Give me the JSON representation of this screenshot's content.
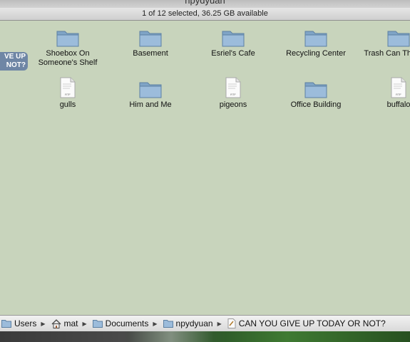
{
  "window": {
    "title": "npydyuan"
  },
  "status": {
    "text": "1 of 12 selected, 36.25 GB available"
  },
  "selected_item": {
    "label_line1": "VE UP",
    "label_line2": "NOT?"
  },
  "items": [
    {
      "label": "Shoebox On Someone's Shelf",
      "icon": "folder-icon"
    },
    {
      "label": "Basement",
      "icon": "folder-icon"
    },
    {
      "label": "Esriel's Cafe",
      "icon": "folder-icon"
    },
    {
      "label": "Recycling Center",
      "icon": "folder-icon"
    },
    {
      "label": "Trash Can The Corr",
      "icon": "folder-icon"
    },
    {
      "label": "gulls",
      "icon": "rtf-document-icon"
    },
    {
      "label": "Him and Me",
      "icon": "folder-icon"
    },
    {
      "label": "pigeons",
      "icon": "rtf-document-icon"
    },
    {
      "label": "Office Building",
      "icon": "folder-icon"
    },
    {
      "label": "buffalo",
      "icon": "rtf-document-icon"
    }
  ],
  "pathbar": {
    "crumbs": [
      {
        "label": "Users",
        "icon": "folder-icon"
      },
      {
        "label": "mat",
        "icon": "home-icon"
      },
      {
        "label": "Documents",
        "icon": "folder-icon"
      },
      {
        "label": "npydyuan",
        "icon": "folder-icon"
      },
      {
        "label": "CAN YOU GIVE UP TODAY OR NOT?",
        "icon": "document-icon"
      }
    ]
  },
  "colors": {
    "content_background": "#c8d4bc",
    "folder_blue": "#8fb2d3",
    "selection_label": "#6f86a5"
  }
}
